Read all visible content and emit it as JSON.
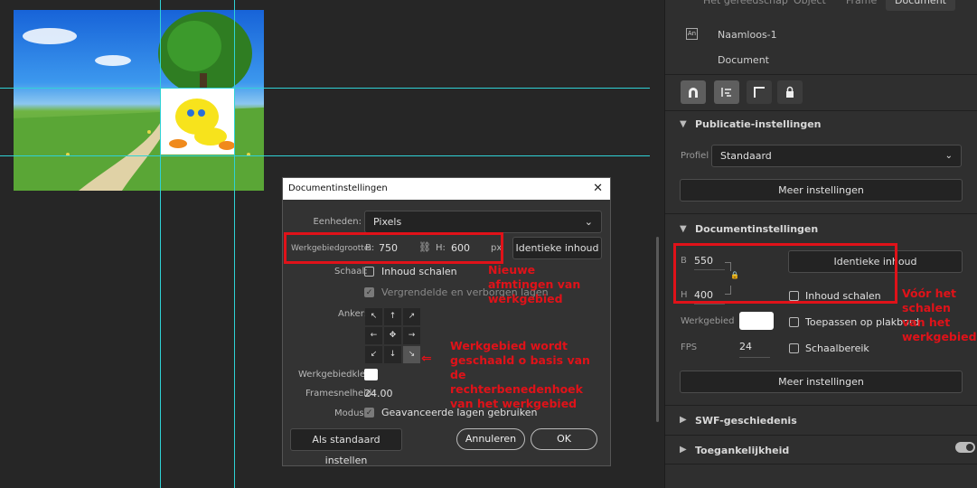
{
  "props": {
    "tabs": [
      "Het gereedschap",
      "Object",
      "Frame",
      "Document"
    ],
    "doc_badge": "An",
    "doc_name": "Naamloos-1",
    "doc_type": "Document",
    "publicatie": {
      "title": "Publicatie-instellingen",
      "profiel_label": "Profiel",
      "profiel_value": "Standaard",
      "meer": "Meer instellingen"
    },
    "docinst": {
      "title": "Documentinstellingen",
      "b_label": "B",
      "b_value": "550",
      "h_label": "H",
      "h_value": "400",
      "identieke": "Identieke inhoud",
      "inhoud_schalen": "Inhoud schalen",
      "werkgebied_label": "Werkgebied",
      "plakbord": "Toepassen op plakbord",
      "fps_label": "FPS",
      "fps_value": "24",
      "schaalbereik": "Schaalbereik",
      "meer": "Meer instellingen"
    },
    "swf": "SWF-geschiedenis",
    "toegankelijkheid": "Toegankelijkheid"
  },
  "dialog": {
    "title": "Documentinstellingen",
    "close": "✕",
    "eenheden_label": "Eenheden:",
    "eenheden_value": "Pixels",
    "grootte_label": "Werkgebiedgrootte:",
    "b_label": "B:",
    "b_value": "750",
    "h_label": "H:",
    "h_value": "600",
    "unit": "px",
    "identieke": "Identieke inhoud",
    "schaal_label": "Schaal:",
    "inhoud_schalen": "Inhoud schalen",
    "vergrendelde": "Vergrendelde en verborgen lagen",
    "anker_label": "Anker:",
    "kleur_label": "Werkgebiedkleur:",
    "frames_label": "Framesnelheid:",
    "frames_value": "24.00",
    "modus_label": "Modus:",
    "modus_value": "Geavanceerde lagen gebruiken",
    "standaard": "Als standaard instellen",
    "annuleren": "Annuleren",
    "ok": "OK"
  },
  "annotations": {
    "nieuwe": "Nieuwe afmtingen van werkgebied",
    "geschaald": "Werkgebied wordt geschaald o basis van de rechterbenedenhoek van het werkgebied",
    "voor": "Vóór het schalen van het werkgebied"
  },
  "colors": {
    "guide": "#2fd2d6",
    "annotation": "#e01219"
  }
}
